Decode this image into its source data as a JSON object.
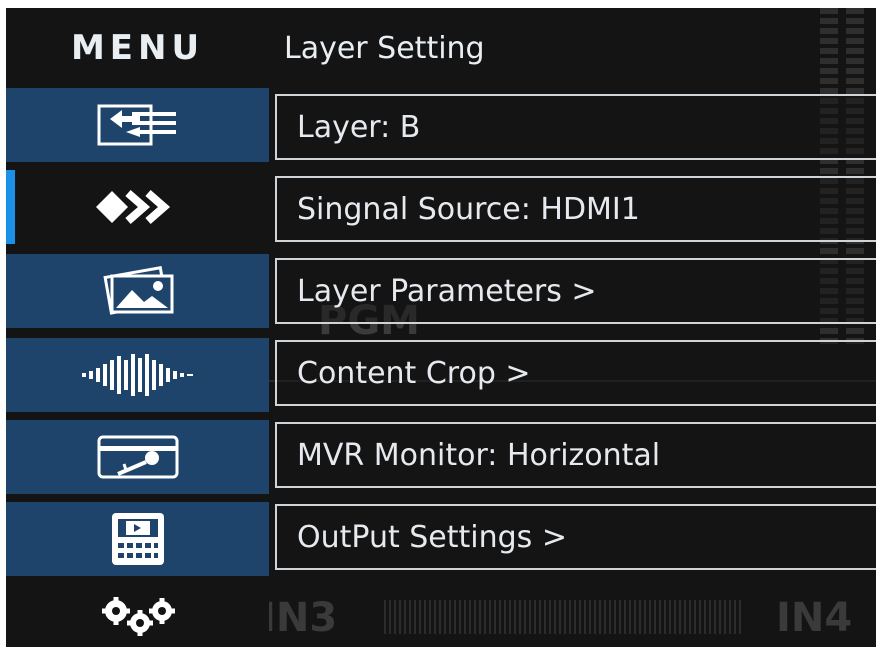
{
  "header": {
    "menu_title": "MENU",
    "page_title": "Layer Setting"
  },
  "sidebar": {
    "items": [
      {
        "icon": "input-switch-icon",
        "active": false
      },
      {
        "icon": "signal-forward-icon",
        "active": true
      },
      {
        "icon": "image-gallery-icon",
        "active": false
      },
      {
        "icon": "audio-waveform-icon",
        "active": false
      },
      {
        "icon": "key-card-icon",
        "active": false
      },
      {
        "icon": "media-preset-icon",
        "active": false
      },
      {
        "icon": "gears-icon",
        "active": false
      }
    ]
  },
  "list": {
    "items": [
      {
        "label": "Layer: B"
      },
      {
        "label": "Singnal Source: HDMI1"
      },
      {
        "label": "Layer Parameters >"
      },
      {
        "label": "Content Crop >"
      },
      {
        "label": "MVR Monitor: Horizontal"
      },
      {
        "label": "OutPut Settings >"
      }
    ]
  },
  "background": {
    "pgm_label": "PGM",
    "in3_label": "IN3",
    "in4_label": "IN4"
  },
  "colors": {
    "sidebar_item": "#1f446b",
    "active_indicator": "#1a90e8",
    "screen_bg": "#141414",
    "text": "#e6eaee"
  }
}
